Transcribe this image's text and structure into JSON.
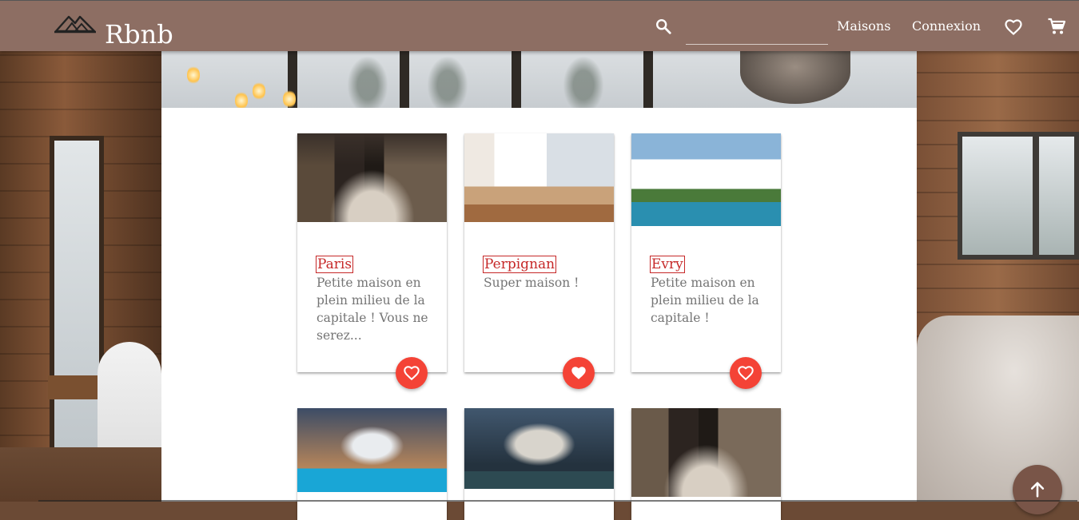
{
  "app": {
    "brand": "Rbnb",
    "search_placeholder": ""
  },
  "nav": {
    "maisons": "Maisons",
    "connexion": "Connexion"
  },
  "icons": {
    "logo": "house-mountain-logo-icon",
    "search": "search-icon",
    "favorites": "heart-outline-icon",
    "cart": "shopping-cart-icon",
    "card_favorite": "heart-outline-icon",
    "scroll_top": "arrow-up-icon"
  },
  "colors": {
    "appbar": "#8d6e63",
    "accent": "#f44336",
    "title": "#c62828",
    "scroll_button": "#795548"
  },
  "listings": [
    {
      "city": "Paris",
      "description": "Petite maison en plein milieu de la capitale ! Vous ne serez...",
      "favorite": false
    },
    {
      "city": "Perpignan",
      "description": "Super maison !",
      "favorite": true
    },
    {
      "city": "Evry",
      "description": "Petite maison en plein milieu de la capitale !",
      "favorite": false
    },
    {
      "city": "",
      "description": "",
      "favorite": false
    },
    {
      "city": "",
      "description": "",
      "favorite": false
    },
    {
      "city": "",
      "description": "",
      "favorite": false
    }
  ]
}
